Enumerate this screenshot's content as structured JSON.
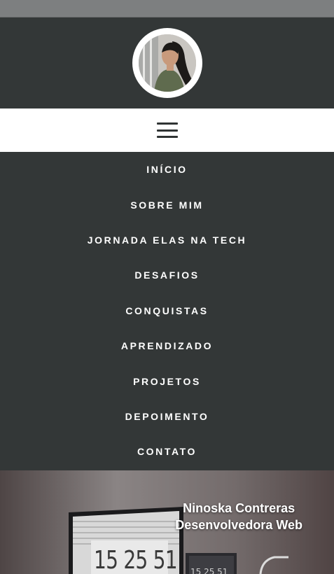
{
  "menu": {
    "items": [
      {
        "label": "INÍCIO"
      },
      {
        "label": "SOBRE MIM"
      },
      {
        "label": "JORNADA ELAS NA TECH"
      },
      {
        "label": "DESAFIOS"
      },
      {
        "label": "CONQUISTAS"
      },
      {
        "label": "APRENDIZADO"
      },
      {
        "label": "PROJETOS"
      },
      {
        "label": "DEPOIMENTO"
      },
      {
        "label": "CONTATO"
      }
    ]
  },
  "hero": {
    "name": "Ninoska Contreras",
    "role": "Desenvolvedora Web",
    "clock_large": "15 25 51",
    "clock_small": "15 25 51"
  },
  "colors": {
    "header_bg": "#333737",
    "menu_text": "#ffffff",
    "top_strip": "#7d7f80"
  }
}
